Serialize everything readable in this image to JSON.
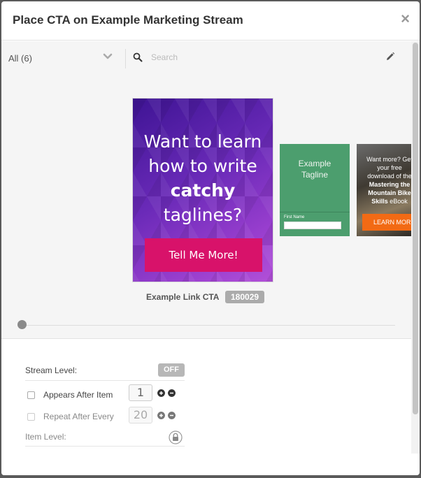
{
  "modal": {
    "title": "Place CTA on Example Marketing Stream",
    "close_icon": "close-icon"
  },
  "toolbar": {
    "filter_label": "All (6)",
    "search_placeholder": "Search",
    "icons": [
      "chevron-down-icon",
      "search-icon",
      "pencil-icon"
    ]
  },
  "ctas": {
    "selected": {
      "lines": [
        "Want to learn",
        "how to write",
        "catchy",
        "taglines?"
      ],
      "button": "Tell Me More!",
      "name": "Example Link CTA",
      "id": "180029"
    },
    "green": {
      "tagline_1": "Example",
      "tagline_2": "Tagline",
      "field_label": "First Name"
    },
    "orange": {
      "line_1": "Want more? Get",
      "line_2": "your free",
      "line_3": "download of the",
      "bold_1": "Mastering the",
      "bold_2": "Mountain Bike",
      "bold_3": "Skills",
      "suffix": " eBook",
      "button": "LEARN MORE"
    }
  },
  "slider": {
    "position": 0.0
  },
  "settings": {
    "stream_level_label": "Stream Level:",
    "stream_level_toggle": "OFF",
    "appears_after_label": "Appears After Item",
    "appears_after_value": "1",
    "repeat_after_label": "Repeat After Every",
    "repeat_after_value": "20",
    "item_level_label": "Item Level:"
  },
  "colors": {
    "cta_button": "#d8126a",
    "cta_green": "#4c9e6e",
    "cta_orange_button": "#f26a14",
    "toggle_off": "#b7b7b7",
    "id_badge": "#ababab"
  }
}
